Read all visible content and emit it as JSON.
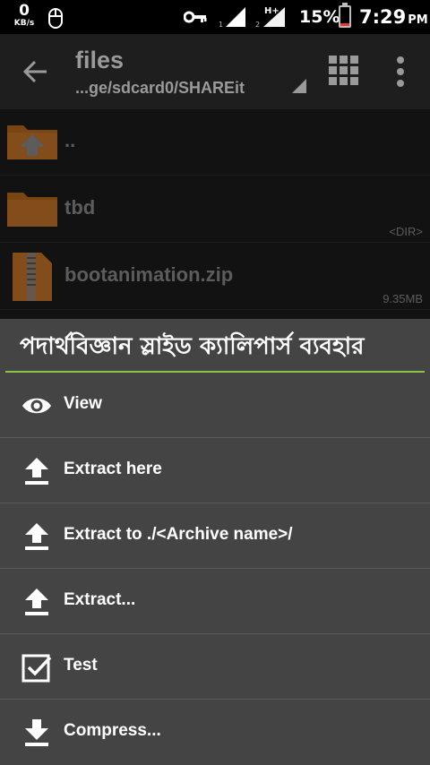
{
  "status_bar": {
    "net_speed": "0",
    "net_unit": "KB/s",
    "sim1_label": "1",
    "sim2_label": "2",
    "network_type": "H+",
    "battery_percent": "15%",
    "battery_level": 0.15,
    "time": "7:29",
    "ampm": "PM"
  },
  "app_bar": {
    "title": "files",
    "path": "...ge/sdcard0/SHAREit"
  },
  "files": [
    {
      "name": "..",
      "meta": "",
      "icon": "folder-up-icon"
    },
    {
      "name": "tbd",
      "meta": "<DIR>",
      "icon": "folder-icon"
    },
    {
      "name": "bootanimation.zip",
      "meta": "9.35MB",
      "icon": "zip-file-icon"
    }
  ],
  "dialog": {
    "title": "পদার্থবিজ্ঞান স্লাইড ক্যালিপার্স ব্যবহার",
    "items": [
      {
        "label": "View",
        "icon": "eye-icon"
      },
      {
        "label": "Extract here",
        "icon": "upload-icon"
      },
      {
        "label": "Extract to ./<Archive name>/",
        "icon": "upload-icon"
      },
      {
        "label": "Extract...",
        "icon": "upload-icon"
      },
      {
        "label": "Test",
        "icon": "checkbox-icon"
      },
      {
        "label": "Compress...",
        "icon": "download-icon"
      }
    ]
  },
  "colors": {
    "accent": "#8bc34a",
    "folder": "#b86a1e",
    "battery_low": "#e53935"
  }
}
